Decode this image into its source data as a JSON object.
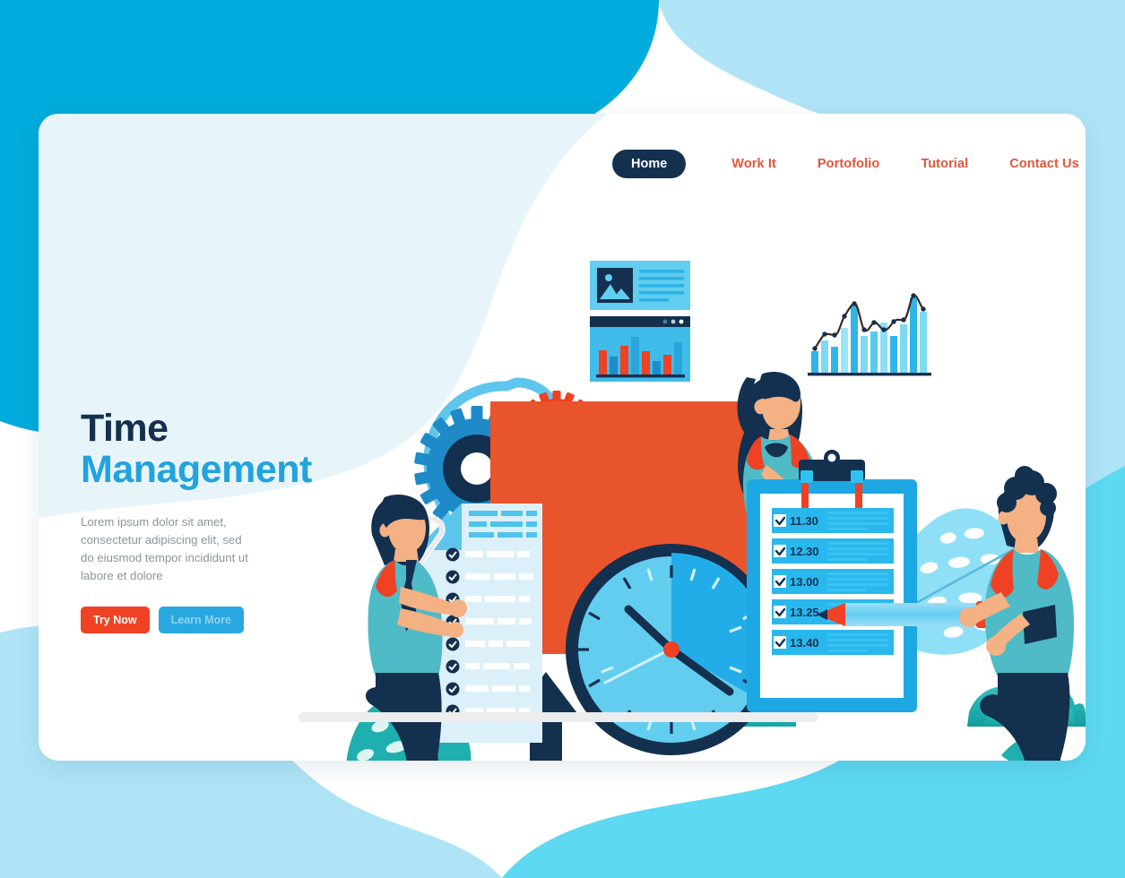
{
  "page": {
    "title": "Time Management Landing Page",
    "bg_cyan": "#00ACDD",
    "bg_light_cyan": "#5ED9F2",
    "bg_pale_blue": "#AFE4F7",
    "card_bg": "#FFFFFF",
    "card_tint": "#E7F5FB"
  },
  "nav": {
    "active": "Home",
    "items": [
      {
        "label": "Home",
        "active": true
      },
      {
        "label": "Work It",
        "active": false
      },
      {
        "label": "Portofolio",
        "active": false
      },
      {
        "label": "Tutorial",
        "active": false
      },
      {
        "label": "Contact Us",
        "active": false
      }
    ],
    "active_bg": "#14304F",
    "active_color": "#FFFFFF",
    "link_color": "#E2553A"
  },
  "hero": {
    "title_line1": "Time",
    "title_line2": "Management",
    "title_line1_color": "#14304F",
    "title_line2_color": "#22A3DD",
    "paragraph": "Lorem ipsum dolor sit amet, consectetur adipiscing elit, sed do eiusmod tempor incididunt ut labore et dolore",
    "paragraph_color": "#8D949B",
    "primary_button": "Try Now",
    "primary_button_bg": "#EF4123",
    "secondary_button": "Learn More",
    "secondary_button_bg": "#29A8E0"
  },
  "illustration": {
    "clock": {
      "face_color": "#62CDEF",
      "wedge_color": "#23ADE8",
      "rim_color": "#14304F",
      "center_dot_color": "#EF4123",
      "hour_hand_angle_deg": -30,
      "minute_hand_angle_deg": 115,
      "tick_count": 12
    },
    "speech_bubble_color": "#E8542C",
    "gears": {
      "big_gear_color": "#1E8BC8",
      "big_gear_hub_color": "#14304F",
      "small_gear_color": "#EF4123",
      "small_gear_hub_color": "#14304F",
      "belt_color": "#5EC6EC"
    },
    "dashboard_card": {
      "bg_color": "#62CDEF",
      "image_placeholder_color": "#14304F",
      "text_line_color": "#23ADE8",
      "text_line_count": 5
    },
    "browser_window": {
      "titlebar_color": "#14304F",
      "body_color": "#3FBCEA",
      "dot_count": 3,
      "bar_values": [
        46,
        34,
        55,
        72,
        44,
        26,
        38,
        62
      ],
      "bar_colors": [
        "#EF4123",
        "#1E8BC8",
        "#EF4123",
        "#2AA5DC",
        "#EF4123",
        "#1E8BC8",
        "#EF4123",
        "#2AA5DC"
      ]
    },
    "combo_chart": {
      "bar_values": [
        22,
        40,
        30,
        56,
        84,
        46,
        52,
        62,
        46,
        60,
        94,
        76
      ],
      "bar_colors": [
        "#2FB5E8",
        "#7FD9F2",
        "#2FB5E8",
        "#9BE3F6",
        "#2FB5E8",
        "#7FD9F2",
        "#57CBEE",
        "#8EDEF4",
        "#2FB5E8",
        "#7FD9F2",
        "#2FB5E8",
        "#7FD9F2"
      ],
      "line_values": [
        30,
        48,
        46,
        62,
        96,
        66,
        72,
        66,
        74,
        70,
        100,
        84
      ],
      "line_color": "#3A2A22",
      "point_color": "#14304F",
      "baseline_color": "#14304F"
    },
    "clipboard": {
      "frame_color": "#1EA8E3",
      "page_color": "#FFFFFF",
      "clamp_color": "#14304F",
      "clip_wire_color": "#EF4123",
      "row_bg_color": "#29B8ED",
      "row_text_color": "#14304F",
      "check_box_color": "#FFFFFF",
      "rows": [
        {
          "time": "11.30",
          "checked": true
        },
        {
          "time": "12.30",
          "checked": true
        },
        {
          "time": "13.00",
          "checked": true
        },
        {
          "time": "13.25",
          "checked": true
        },
        {
          "time": "13.40",
          "checked": true
        }
      ]
    },
    "checklist_document": {
      "paper_color": "#DCF0FA",
      "corner_color": "#5EC6EC",
      "paperclip_color": "#F2F2F2",
      "header_line_color": "#4FC3EC",
      "check_circle_color": "#14304F",
      "row_count": 8
    },
    "pencil": {
      "body_color": "#6FD0F1",
      "tip_color": "#EF4123",
      "lead_color": "#14304F",
      "eraser_color": "#EF4123"
    },
    "arrow_up_color": "#14304F",
    "people": [
      {
        "name": "man-with-checklist",
        "skin": "#F4B183",
        "hair": "#14304F",
        "shirt": "#4FBBC6",
        "sleeve": "#EF4123",
        "tie": "#14304F",
        "pants": "#14304F"
      },
      {
        "name": "woman-with-laptop",
        "skin": "#F4B183",
        "hair": "#14304F",
        "shirt": "#4FBBC6",
        "sleeve": "#EF4123",
        "pants": "#14304F",
        "laptop": "#3FBCA8"
      },
      {
        "name": "man-with-pencil",
        "skin": "#F4B183",
        "hair": "#14304F",
        "shirt": "#4FBBC6",
        "sleeve": "#EF4123",
        "pants": "#14304F"
      }
    ],
    "foliage": {
      "bush_color_a": "#2BB9B0",
      "bush_color_b": "#3CC7C0",
      "leaf_teal": "#1FA8A2",
      "leaf_blue": "#7FD9F2"
    },
    "ground_color": "#E8E8E8"
  }
}
